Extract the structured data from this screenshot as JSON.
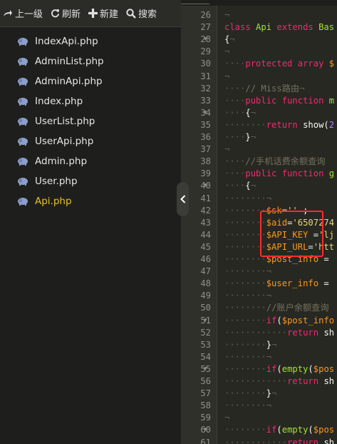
{
  "toolbar": {
    "up_label": "上一级",
    "refresh_label": "刷新",
    "new_label": "新建",
    "search_label": "搜索"
  },
  "files": [
    {
      "name": "IndexApi.php",
      "active": false
    },
    {
      "name": "AdminList.php",
      "active": false
    },
    {
      "name": "AdminApi.php",
      "active": false
    },
    {
      "name": "Index.php",
      "active": false
    },
    {
      "name": "UserList.php",
      "active": false
    },
    {
      "name": "UserApi.php",
      "active": false
    },
    {
      "name": "Admin.php",
      "active": false
    },
    {
      "name": "User.php",
      "active": false
    },
    {
      "name": "Api.php",
      "active": true
    }
  ],
  "code_lines": [
    {
      "n": "26",
      "fold": "",
      "tokens": [
        [
          "ws",
          "¬"
        ]
      ]
    },
    {
      "n": "27",
      "fold": "",
      "tokens": [
        [
          "kw",
          "class "
        ],
        [
          "cls",
          "Api "
        ],
        [
          "kw",
          "extends "
        ],
        [
          "cls",
          "Bas"
        ]
      ]
    },
    {
      "n": "28",
      "fold": "▾",
      "tokens": [
        [
          "",
          "{"
        ],
        [
          "ws",
          "¬"
        ]
      ]
    },
    {
      "n": "29",
      "fold": "",
      "tokens": [
        [
          "ws",
          "¬"
        ]
      ]
    },
    {
      "n": "30",
      "fold": "",
      "tokens": [
        [
          "ws",
          "····"
        ],
        [
          "kw",
          "protected "
        ],
        [
          "kw",
          "array "
        ],
        [
          "var",
          "$"
        ]
      ]
    },
    {
      "n": "31",
      "fold": "",
      "tokens": [
        [
          "ws",
          "¬"
        ]
      ]
    },
    {
      "n": "32",
      "fold": "",
      "tokens": [
        [
          "ws",
          "····"
        ],
        [
          "cm",
          "// Miss路由"
        ],
        [
          "ws",
          "¬"
        ]
      ]
    },
    {
      "n": "33",
      "fold": "",
      "tokens": [
        [
          "ws",
          "····"
        ],
        [
          "kw",
          "public "
        ],
        [
          "kw",
          "function "
        ],
        [
          "fn",
          "m"
        ]
      ]
    },
    {
      "n": "34",
      "fold": "▾",
      "tokens": [
        [
          "ws",
          "····"
        ],
        [
          "",
          "{"
        ],
        [
          "ws",
          "¬"
        ]
      ]
    },
    {
      "n": "35",
      "fold": "",
      "tokens": [
        [
          "ws",
          "········"
        ],
        [
          "kw",
          "return "
        ],
        [
          "",
          "show("
        ],
        [
          "num",
          "2"
        ]
      ]
    },
    {
      "n": "36",
      "fold": "",
      "tokens": [
        [
          "ws",
          "····"
        ],
        [
          "",
          "}"
        ],
        [
          "ws",
          "¬"
        ]
      ]
    },
    {
      "n": "37",
      "fold": "",
      "tokens": [
        [
          "ws",
          "¬"
        ]
      ]
    },
    {
      "n": "38",
      "fold": "",
      "tokens": [
        [
          "ws",
          "····"
        ],
        [
          "cm",
          "//手机话费余额查询"
        ]
      ]
    },
    {
      "n": "39",
      "fold": "",
      "tokens": [
        [
          "ws",
          "····"
        ],
        [
          "kw",
          "public "
        ],
        [
          "kw",
          "function "
        ],
        [
          "fn",
          "g"
        ]
      ]
    },
    {
      "n": "40",
      "fold": "▾",
      "tokens": [
        [
          "ws",
          "····"
        ],
        [
          "",
          "{"
        ],
        [
          "ws",
          "¬"
        ]
      ]
    },
    {
      "n": "41",
      "fold": "",
      "tokens": [
        [
          "ws",
          "········¬"
        ]
      ]
    },
    {
      "n": "42",
      "fold": "",
      "tokens": [
        [
          "ws",
          "········"
        ],
        [
          "var",
          "$sk"
        ],
        [
          "",
          "="
        ],
        [
          "str",
          "''"
        ],
        [
          "",
          " ;"
        ]
      ]
    },
    {
      "n": "43",
      "fold": "",
      "tokens": [
        [
          "ws",
          "········"
        ],
        [
          "var",
          "$aid"
        ],
        [
          "",
          "="
        ],
        [
          "str",
          "'6507274"
        ]
      ]
    },
    {
      "n": "44",
      "fold": "",
      "tokens": [
        [
          "ws",
          "········"
        ],
        [
          "var",
          "$API_KEY"
        ],
        [
          "",
          " ="
        ],
        [
          "str",
          "'lj"
        ]
      ]
    },
    {
      "n": "45",
      "fold": "",
      "tokens": [
        [
          "ws",
          "········"
        ],
        [
          "var",
          "$API_URL"
        ],
        [
          "",
          "="
        ],
        [
          "str",
          "'htt"
        ]
      ]
    },
    {
      "n": "46",
      "fold": "",
      "tokens": [
        [
          "ws",
          "········"
        ],
        [
          "var",
          "$post_info"
        ],
        [
          "",
          " ="
        ]
      ]
    },
    {
      "n": "47",
      "fold": "",
      "tokens": [
        [
          "ws",
          "········¬"
        ]
      ]
    },
    {
      "n": "48",
      "fold": "",
      "tokens": [
        [
          "ws",
          "········"
        ],
        [
          "var",
          "$user_info"
        ],
        [
          "",
          " ="
        ]
      ]
    },
    {
      "n": "49",
      "fold": "",
      "tokens": [
        [
          "ws",
          "········¬"
        ]
      ]
    },
    {
      "n": "50",
      "fold": "",
      "tokens": [
        [
          "ws",
          "········"
        ],
        [
          "cm",
          "//账户余额查询"
        ]
      ]
    },
    {
      "n": "51",
      "fold": "▾",
      "tokens": [
        [
          "ws",
          "········"
        ],
        [
          "kw",
          "if"
        ],
        [
          "",
          "("
        ],
        [
          "var",
          "$post_info"
        ]
      ]
    },
    {
      "n": "52",
      "fold": "",
      "tokens": [
        [
          "ws",
          "············"
        ],
        [
          "kw",
          "return "
        ],
        [
          "",
          "sh"
        ]
      ]
    },
    {
      "n": "53",
      "fold": "",
      "tokens": [
        [
          "ws",
          "········"
        ],
        [
          "",
          "}"
        ],
        [
          "ws",
          "¬"
        ]
      ]
    },
    {
      "n": "54",
      "fold": "",
      "tokens": [
        [
          "ws",
          "········¬"
        ]
      ]
    },
    {
      "n": "55",
      "fold": "▾",
      "tokens": [
        [
          "ws",
          "········"
        ],
        [
          "kw",
          "if"
        ],
        [
          "",
          "("
        ],
        [
          "fn",
          "empty"
        ],
        [
          "",
          "("
        ],
        [
          "var",
          "$pos"
        ]
      ]
    },
    {
      "n": "56",
      "fold": "",
      "tokens": [
        [
          "ws",
          "············"
        ],
        [
          "kw",
          "return "
        ],
        [
          "",
          "sh"
        ]
      ]
    },
    {
      "n": "57",
      "fold": "",
      "tokens": [
        [
          "ws",
          "········"
        ],
        [
          "",
          "}"
        ],
        [
          "ws",
          "¬"
        ]
      ]
    },
    {
      "n": "58",
      "fold": "",
      "tokens": [
        [
          "ws",
          "········¬"
        ]
      ]
    },
    {
      "n": "59",
      "fold": "",
      "tokens": [
        [
          "ws",
          "¬"
        ]
      ]
    },
    {
      "n": "60",
      "fold": "▾",
      "tokens": [
        [
          "ws",
          "········"
        ],
        [
          "kw",
          "if"
        ],
        [
          "",
          "("
        ],
        [
          "fn",
          "empty"
        ],
        [
          "",
          "("
        ],
        [
          "var",
          "$pos"
        ]
      ]
    },
    {
      "n": "61",
      "fold": "",
      "tokens": [
        [
          "ws",
          "············"
        ],
        [
          "kw",
          "return "
        ],
        [
          "",
          "sh"
        ]
      ]
    }
  ]
}
